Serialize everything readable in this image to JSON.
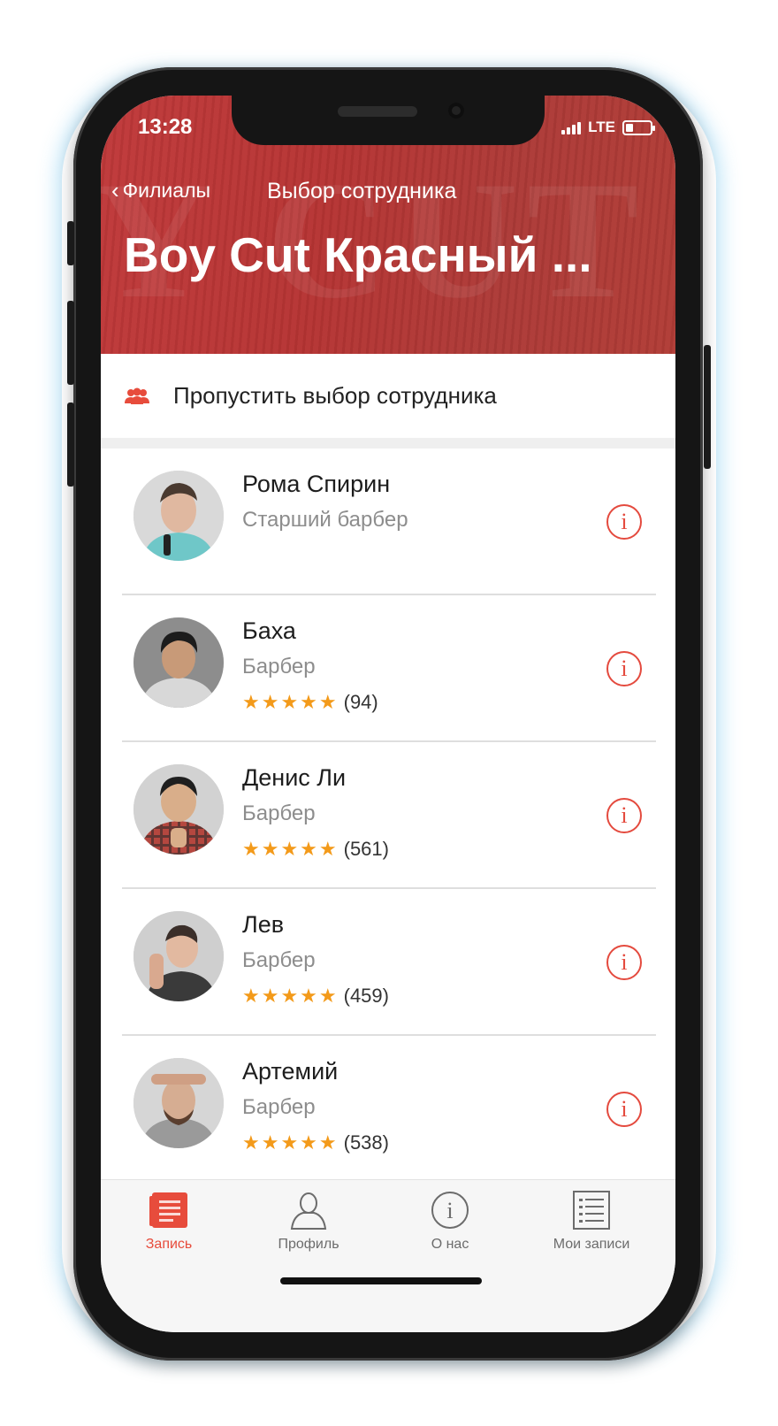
{
  "status_bar": {
    "time": "13:28",
    "network": "LTE"
  },
  "nav": {
    "back_label": "Филиалы",
    "title": "Выбор сотрудника"
  },
  "header": {
    "title": "Boy Cut Красный ..."
  },
  "skip": {
    "label": "Пропустить выбор сотрудника",
    "icon": "people-icon"
  },
  "colors": {
    "accent": "#e74c3c",
    "header_bg": "#b63433",
    "star": "#f39a1a"
  },
  "staff": [
    {
      "name": "Рома Спирин",
      "role": "Старший барбер",
      "stars": "",
      "reviews": ""
    },
    {
      "name": "Баха",
      "role": "Барбер",
      "stars": "★★★★★",
      "reviews": "(94)"
    },
    {
      "name": "Денис Ли",
      "role": "Барбер",
      "stars": "★★★★★",
      "reviews": "(561)"
    },
    {
      "name": "Лев",
      "role": "Барбер",
      "stars": "★★★★★",
      "reviews": "(459)"
    },
    {
      "name": "Артемий",
      "role": "Барбер",
      "stars": "★★★★★",
      "reviews": "(538)"
    }
  ],
  "tabbar": {
    "items": [
      {
        "label": "Запись",
        "icon": "booking-icon",
        "active": true
      },
      {
        "label": "Профиль",
        "icon": "profile-icon",
        "active": false
      },
      {
        "label": "О нас",
        "icon": "info-icon",
        "active": false
      },
      {
        "label": "Мои записи",
        "icon": "list-icon",
        "active": false
      }
    ]
  }
}
